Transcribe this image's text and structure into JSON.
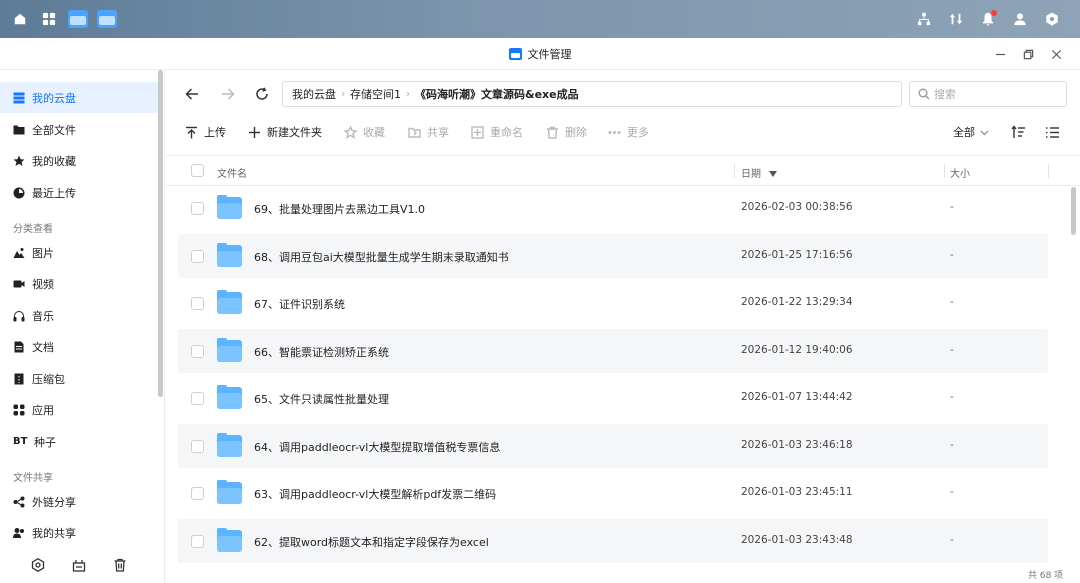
{
  "window": {
    "title": "文件管理"
  },
  "sidebar": {
    "items_top": [
      {
        "label": "我的云盘",
        "icon": "cloud-drive-icon",
        "active": true
      },
      {
        "label": "全部文件",
        "icon": "folder-icon"
      },
      {
        "label": "我的收藏",
        "icon": "star-icon"
      },
      {
        "label": "最近上传",
        "icon": "clock-icon"
      }
    ],
    "section_category": "分类查看",
    "items_category": [
      {
        "label": "图片",
        "icon": "image-icon"
      },
      {
        "label": "视频",
        "icon": "video-icon"
      },
      {
        "label": "音乐",
        "icon": "headphones-icon"
      },
      {
        "label": "文档",
        "icon": "document-icon"
      },
      {
        "label": "压缩包",
        "icon": "archive-icon"
      },
      {
        "label": "应用",
        "icon": "apps-icon"
      },
      {
        "label": "种子",
        "icon_text": "BT"
      }
    ],
    "section_share": "文件共享",
    "items_share": [
      {
        "label": "外链分享",
        "icon": "share-icon"
      },
      {
        "label": "我的共享",
        "icon": "shared-icon"
      }
    ]
  },
  "breadcrumb": [
    "我的云盘",
    "存储空间1",
    "《码海听潮》文章源码&exe成品"
  ],
  "search": {
    "placeholder": "搜索"
  },
  "toolbar": {
    "upload": "上传",
    "new_folder": "新建文件夹",
    "favorite": "收藏",
    "share": "共享",
    "rename": "重命名",
    "delete": "删除",
    "more": "更多",
    "filter": "全部"
  },
  "table": {
    "headers": {
      "name": "文件名",
      "date": "日期",
      "size": "大小"
    },
    "rows": [
      {
        "name": "69、批量处理图片去黑边工具V1.0",
        "date": "2026-02-03 00:38:56",
        "size": "-"
      },
      {
        "name": "68、调用豆包ai大模型批量生成学生期末录取通知书",
        "date": "2026-01-25 17:16:56",
        "size": "-"
      },
      {
        "name": "67、证件识别系统",
        "date": "2026-01-22 13:29:34",
        "size": "-"
      },
      {
        "name": "66、智能票证检测矫正系统",
        "date": "2026-01-12 19:40:06",
        "size": "-"
      },
      {
        "name": "65、文件只读属性批量处理",
        "date": "2026-01-07 13:44:42",
        "size": "-"
      },
      {
        "name": "64、调用paddleocr-vl大模型提取增值税专票信息",
        "date": "2026-01-03 23:46:18",
        "size": "-"
      },
      {
        "name": "63、调用paddleocr-vl大模型解析pdf发票二维码",
        "date": "2026-01-03 23:45:11",
        "size": "-"
      },
      {
        "name": "62、提取word标题文本和指定字段保存为excel",
        "date": "2026-01-03 23:43:48",
        "size": "-"
      }
    ]
  },
  "status": {
    "count": "共 68 项"
  },
  "colors": {
    "accent": "#1677ff",
    "folder": "#5cb3ff",
    "active_bg": "#e8f1ff"
  }
}
